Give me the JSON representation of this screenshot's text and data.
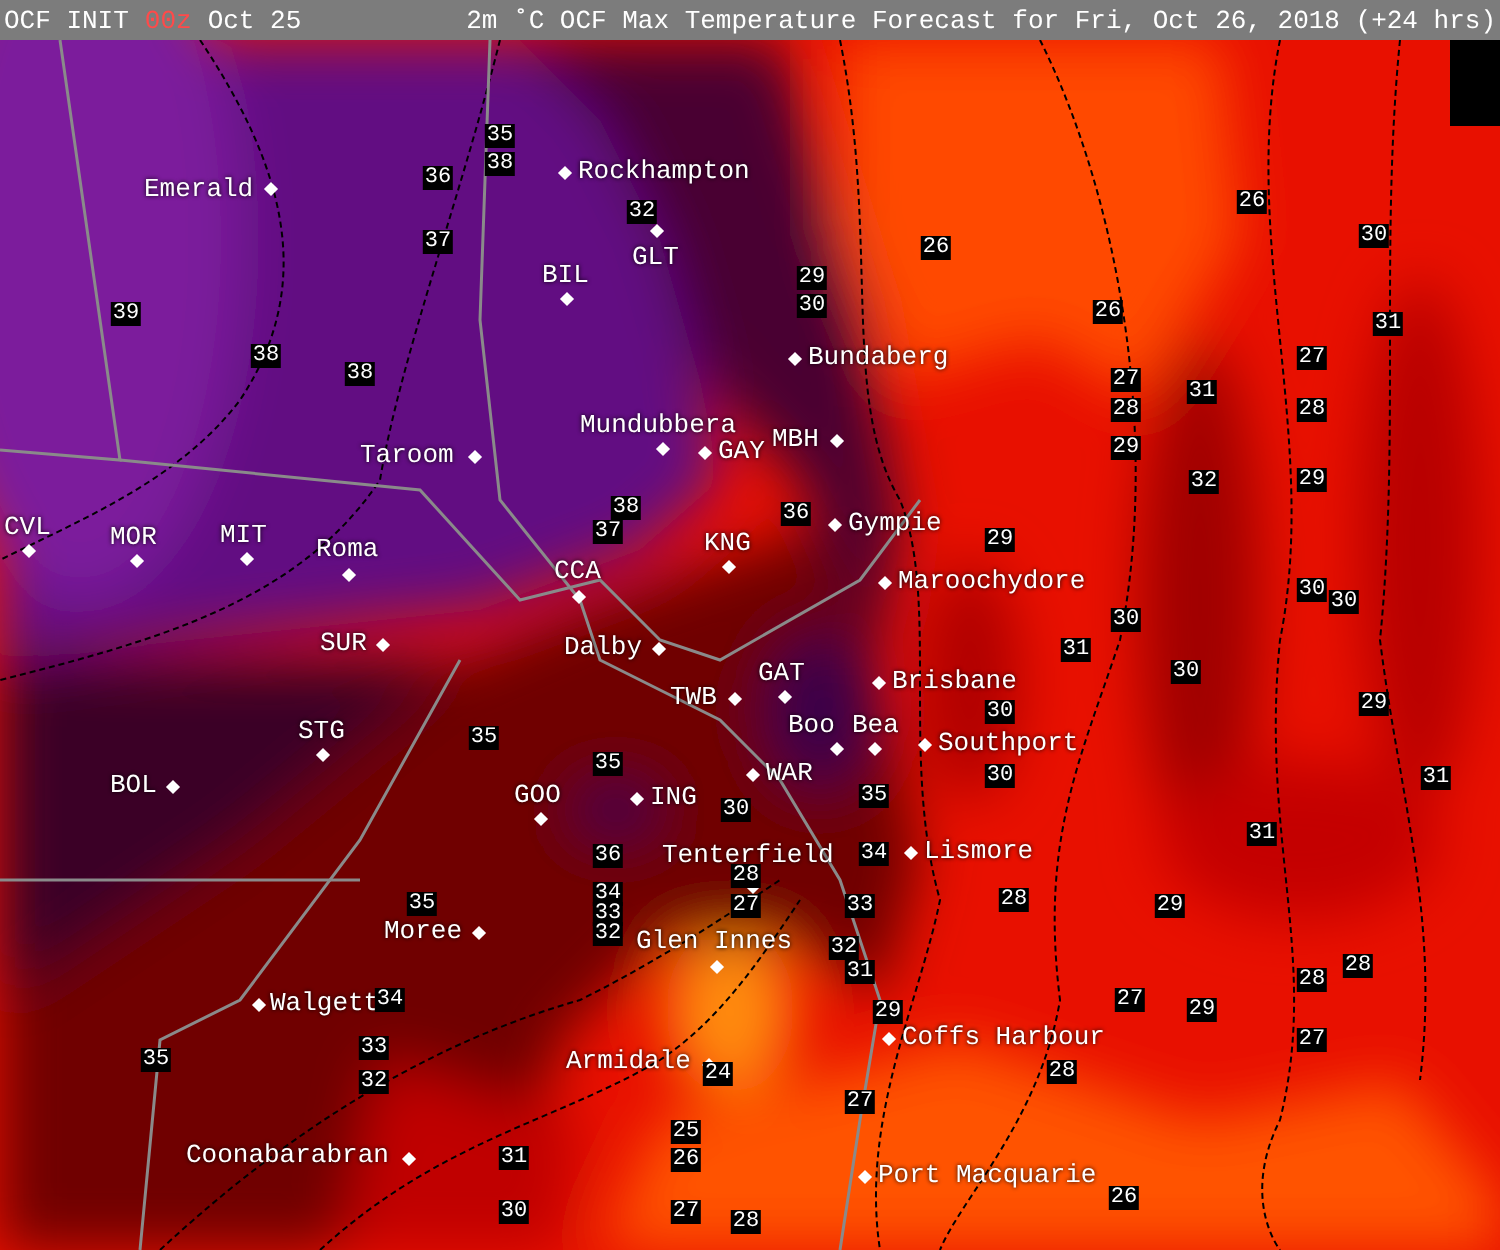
{
  "header": {
    "init_label": "OCF INIT",
    "run": "00z",
    "init_date": "Oct 25",
    "title": "2m ˚C OCF Max Temperature Forecast for Fri, Oct 26, 2018 (+24 hrs)"
  },
  "places": [
    {
      "name": "Emerald"
    },
    {
      "name": "Rockhampton"
    },
    {
      "name": "BIL"
    },
    {
      "name": "GLT"
    },
    {
      "name": "Bundaberg"
    },
    {
      "name": "Taroom"
    },
    {
      "name": "Mundubbera"
    },
    {
      "name": "GAY"
    },
    {
      "name": "MBH"
    },
    {
      "name": "CVL"
    },
    {
      "name": "MOR"
    },
    {
      "name": "MIT"
    },
    {
      "name": "Roma"
    },
    {
      "name": "KNG"
    },
    {
      "name": "Gympie"
    },
    {
      "name": "CCA"
    },
    {
      "name": "Maroochydore"
    },
    {
      "name": "SUR"
    },
    {
      "name": "Dalby"
    },
    {
      "name": "TWB"
    },
    {
      "name": "GAT"
    },
    {
      "name": "Brisbane"
    },
    {
      "name": "STG"
    },
    {
      "name": "Boo"
    },
    {
      "name": "Bea"
    },
    {
      "name": "Southport"
    },
    {
      "name": "BOL"
    },
    {
      "name": "GOO"
    },
    {
      "name": "ING"
    },
    {
      "name": "WAR"
    },
    {
      "name": "Tenterfield"
    },
    {
      "name": "Lismore"
    },
    {
      "name": "Moree"
    },
    {
      "name": "Glen Innes"
    },
    {
      "name": "Walgett"
    },
    {
      "name": "Coffs Harbour"
    },
    {
      "name": "Armidale"
    },
    {
      "name": "Coonabarabran"
    },
    {
      "name": "Port Macquarie"
    }
  ],
  "contour_labels": [
    "35",
    "38",
    "36",
    "37",
    "39",
    "38",
    "38",
    "32",
    "29",
    "30",
    "26",
    "26",
    "26",
    "30",
    "31",
    "27",
    "28",
    "29",
    "31",
    "32",
    "27",
    "28",
    "29",
    "29",
    "36",
    "30",
    "30",
    "30",
    "31",
    "37",
    "38",
    "30",
    "29",
    "31",
    "30",
    "30",
    "35",
    "31",
    "34",
    "28",
    "29",
    "28",
    "28",
    "33",
    "32",
    "31",
    "29",
    "28",
    "27",
    "29",
    "27",
    "27",
    "26",
    "35",
    "35",
    "30",
    "36",
    "34",
    "33",
    "32",
    "35",
    "28",
    "27",
    "34",
    "33",
    "32",
    "35",
    "24",
    "25",
    "26",
    "31",
    "30",
    "27",
    "28"
  ]
}
